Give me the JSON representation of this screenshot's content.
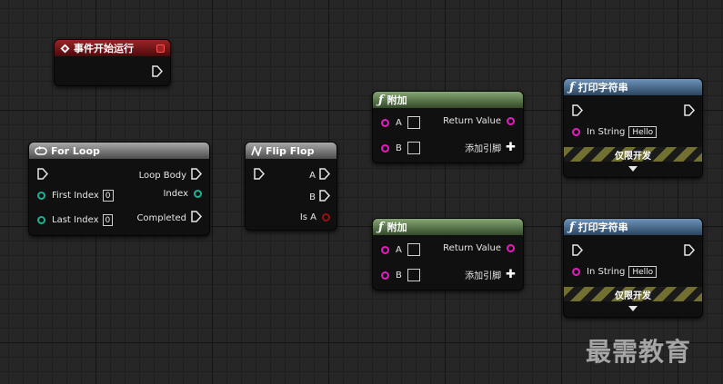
{
  "nodes": {
    "event_start": {
      "title": "事件开始运行"
    },
    "for_loop": {
      "title": "For Loop",
      "loop_body": "Loop Body",
      "first_index": "First Index",
      "first_index_value": "0",
      "index": "Index",
      "last_index": "Last Index",
      "last_index_value": "0",
      "completed": "Completed"
    },
    "flip_flop": {
      "title": "Flip Flop",
      "a": "A",
      "b": "B",
      "is_a": "Is A"
    },
    "append_1": {
      "title": "附加",
      "a": "A",
      "b": "B",
      "return_value": "Return Value",
      "add_pin": "添加引脚"
    },
    "append_2": {
      "title": "附加",
      "a": "A",
      "b": "B",
      "return_value": "Return Value",
      "add_pin": "添加引脚"
    },
    "print_1": {
      "title": "打印字符串",
      "in_string": "In String",
      "in_string_value": "Hello",
      "dev_only": "仅限开发"
    },
    "print_2": {
      "title": "打印字符串",
      "in_string": "In String",
      "in_string_value": "Hello",
      "dev_only": "仅限开发"
    }
  },
  "watermark": "最需教育",
  "colors": {
    "event": "#9b2224",
    "pure": "#a9a9a9",
    "string_fn": "#86a873",
    "print_fn": "#6d93b9",
    "int_pin": "#1bb394",
    "string_pin": "#e21cbf",
    "bool_pin": "#9a1010"
  }
}
